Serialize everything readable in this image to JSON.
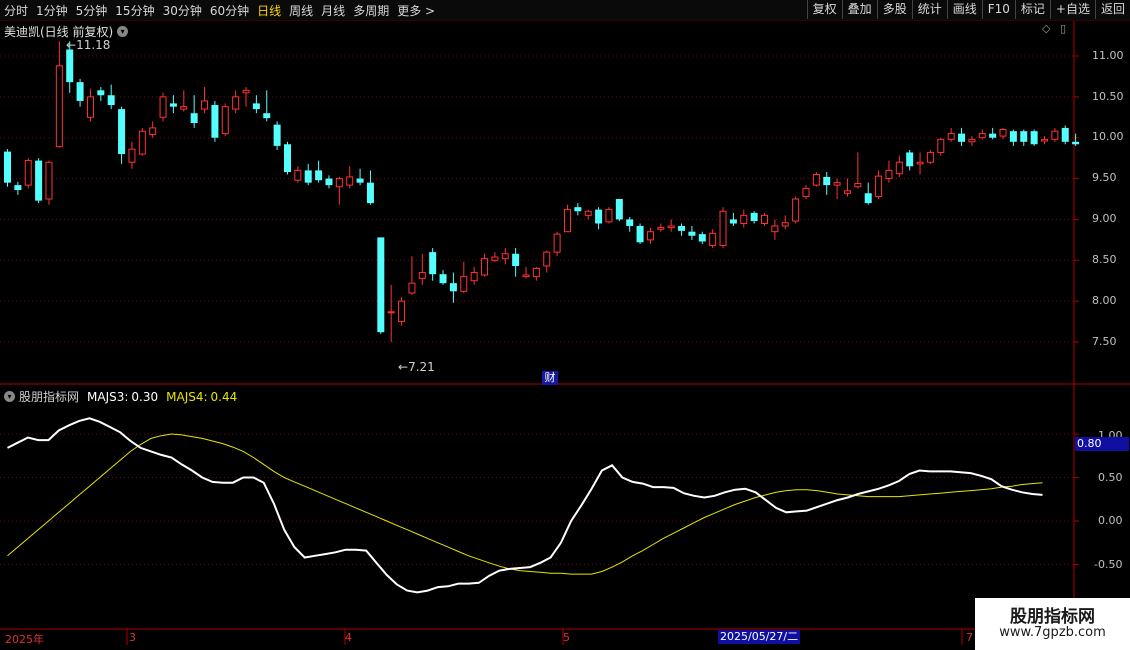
{
  "toolbar": {
    "periods": [
      "分时",
      "1分钟",
      "5分钟",
      "15分钟",
      "30分钟",
      "60分钟",
      "日线",
      "周线",
      "月线",
      "多周期",
      "更多 >"
    ],
    "active_period": "日线",
    "right_buttons": [
      "复权",
      "叠加",
      "多股",
      "统计",
      "画线",
      "F10",
      "标记",
      "+自选",
      "返回"
    ]
  },
  "stock": {
    "title": "美迪凯(日线 前复权)"
  },
  "price_axis": {
    "labels": [
      "11.00",
      "10.50",
      "10.00",
      "9.50",
      "9.00",
      "8.50",
      "8.00",
      "7.50"
    ]
  },
  "annotations": {
    "high": "11.18",
    "low": "7.21",
    "event_marker": "财"
  },
  "indicator": {
    "name": "股朋指标网",
    "majs3_label": "MAJS3:",
    "majs3_value": "0.30",
    "majs4_label": "MAJS4:",
    "majs4_value": "0.44",
    "axis_labels": [
      "0.50",
      "0.00",
      "-0.50"
    ],
    "axis_top_partial": "1.00",
    "cursor_value": "0.80"
  },
  "time_axis": {
    "labels": [
      "2025年",
      "3",
      "4",
      "5",
      "7"
    ],
    "cursor_date": "2025/05/27/二"
  },
  "watermark": {
    "line1": "股朋指标网",
    "line2": "www.7gpzb.com"
  },
  "colors": {
    "up": "#ff3232",
    "down": "#54ffff",
    "majs3": "#ffffff",
    "majs4": "#e6e600",
    "grid": "#7a0000",
    "axis_line": "#b00000",
    "cursor_bg": "#1010a0"
  },
  "chart_data": {
    "type": "candlestick",
    "price_ylim": [
      7.2,
      11.2
    ],
    "candles": [
      [
        9.83,
        9.45,
        9.86,
        9.4
      ],
      [
        9.42,
        9.36,
        9.46,
        9.3
      ],
      [
        9.42,
        9.72,
        9.75,
        9.38
      ],
      [
        9.72,
        9.23,
        9.75,
        9.2
      ],
      [
        9.25,
        9.7,
        9.72,
        9.18
      ],
      [
        9.89,
        10.88,
        11.18,
        9.88
      ],
      [
        11.08,
        10.68,
        11.18,
        10.55
      ],
      [
        10.68,
        10.45,
        10.72,
        10.38
      ],
      [
        10.25,
        10.5,
        10.6,
        10.2
      ],
      [
        10.58,
        10.52,
        10.62,
        10.45
      ],
      [
        10.52,
        10.4,
        10.65,
        10.35
      ],
      [
        10.35,
        9.8,
        10.38,
        9.68
      ],
      [
        9.7,
        9.86,
        9.95,
        9.62
      ],
      [
        9.8,
        10.08,
        10.12,
        9.78
      ],
      [
        10.04,
        10.12,
        10.2,
        10.0
      ],
      [
        10.25,
        10.5,
        10.55,
        10.2
      ],
      [
        10.42,
        10.38,
        10.52,
        10.3
      ],
      [
        10.35,
        10.38,
        10.58,
        10.32
      ],
      [
        10.3,
        10.18,
        10.52,
        10.12
      ],
      [
        10.35,
        10.45,
        10.62,
        10.3
      ],
      [
        10.4,
        10.0,
        10.45,
        9.95
      ],
      [
        10.05,
        10.38,
        10.42,
        10.02
      ],
      [
        10.35,
        10.5,
        10.58,
        10.3
      ],
      [
        10.55,
        10.58,
        10.62,
        10.38
      ],
      [
        10.42,
        10.35,
        10.52,
        10.3
      ],
      [
        10.3,
        10.24,
        10.58,
        10.2
      ],
      [
        10.16,
        9.9,
        10.2,
        9.85
      ],
      [
        9.92,
        9.58,
        9.95,
        9.55
      ],
      [
        9.48,
        9.6,
        9.65,
        9.45
      ],
      [
        9.6,
        9.45,
        9.68,
        9.42
      ],
      [
        9.6,
        9.48,
        9.72,
        9.45
      ],
      [
        9.5,
        9.42,
        9.54,
        9.38
      ],
      [
        9.4,
        9.5,
        9.52,
        9.18
      ],
      [
        9.42,
        9.52,
        9.65,
        9.38
      ],
      [
        9.5,
        9.45,
        9.62,
        9.42
      ],
      [
        9.45,
        9.2,
        9.6,
        9.18
      ],
      [
        8.78,
        7.62,
        8.78,
        7.6
      ],
      [
        7.87,
        7.87,
        8.2,
        7.5
      ],
      [
        7.75,
        8.0,
        8.05,
        7.7
      ],
      [
        8.1,
        8.22,
        8.55,
        8.08
      ],
      [
        8.28,
        8.35,
        8.58,
        8.2
      ],
      [
        8.6,
        8.33,
        8.65,
        8.25
      ],
      [
        8.33,
        8.22,
        8.38,
        8.2
      ],
      [
        8.22,
        8.12,
        8.35,
        7.98
      ],
      [
        8.12,
        8.3,
        8.48,
        8.1
      ],
      [
        8.25,
        8.35,
        8.42,
        8.2
      ],
      [
        8.32,
        8.52,
        8.58,
        8.3
      ],
      [
        8.5,
        8.54,
        8.6,
        8.48
      ],
      [
        8.52,
        8.58,
        8.65,
        8.45
      ],
      [
        8.58,
        8.43,
        8.65,
        8.3
      ],
      [
        8.3,
        8.32,
        8.42,
        8.28
      ],
      [
        8.3,
        8.4,
        8.42,
        8.25
      ],
      [
        8.43,
        8.6,
        8.62,
        8.35
      ],
      [
        8.6,
        8.82,
        8.85,
        8.55
      ],
      [
        8.85,
        9.12,
        9.18,
        8.85
      ],
      [
        9.15,
        9.1,
        9.2,
        9.05
      ],
      [
        9.05,
        9.1,
        9.12,
        9.0
      ],
      [
        9.12,
        8.95,
        9.15,
        8.88
      ],
      [
        8.97,
        9.12,
        9.15,
        8.95
      ],
      [
        9.25,
        9.0,
        9.25,
        8.98
      ],
      [
        9.0,
        8.92,
        9.03,
        8.85
      ],
      [
        8.92,
        8.72,
        8.95,
        8.7
      ],
      [
        8.75,
        8.85,
        8.9,
        8.7
      ],
      [
        8.88,
        8.9,
        8.95,
        8.85
      ],
      [
        8.9,
        8.92,
        9.0,
        8.85
      ],
      [
        8.92,
        8.86,
        8.95,
        8.8
      ],
      [
        8.85,
        8.8,
        8.92,
        8.75
      ],
      [
        8.82,
        8.73,
        8.85,
        8.7
      ],
      [
        8.68,
        8.83,
        8.88,
        8.65
      ],
      [
        8.68,
        9.1,
        9.15,
        8.65
      ],
      [
        9.0,
        8.95,
        9.08,
        8.92
      ],
      [
        8.95,
        9.05,
        9.12,
        8.9
      ],
      [
        9.08,
        8.98,
        9.1,
        8.95
      ],
      [
        8.95,
        9.05,
        9.08,
        8.92
      ],
      [
        8.85,
        8.92,
        9.0,
        8.75
      ],
      [
        8.92,
        8.96,
        9.05,
        8.88
      ],
      [
        8.98,
        9.25,
        9.28,
        8.95
      ],
      [
        9.28,
        9.38,
        9.42,
        9.25
      ],
      [
        9.42,
        9.55,
        9.58,
        9.4
      ],
      [
        9.52,
        9.42,
        9.58,
        9.3
      ],
      [
        9.42,
        9.45,
        9.5,
        9.25
      ],
      [
        9.32,
        9.35,
        9.5,
        9.28
      ],
      [
        9.4,
        9.44,
        9.82,
        9.38
      ],
      [
        9.32,
        9.2,
        9.45,
        9.18
      ],
      [
        9.28,
        9.53,
        9.6,
        9.25
      ],
      [
        9.5,
        9.6,
        9.72,
        9.45
      ],
      [
        9.56,
        9.7,
        9.78,
        9.52
      ],
      [
        9.82,
        9.65,
        9.85,
        9.6
      ],
      [
        9.68,
        9.7,
        9.82,
        9.55
      ],
      [
        9.7,
        9.82,
        9.85,
        9.68
      ],
      [
        9.82,
        9.98,
        10.0,
        9.78
      ],
      [
        9.98,
        10.05,
        10.12,
        9.95
      ],
      [
        10.05,
        9.95,
        10.12,
        9.9
      ],
      [
        9.95,
        9.98,
        10.02,
        9.9
      ],
      [
        10.0,
        10.05,
        10.1,
        9.98
      ],
      [
        10.05,
        10.0,
        10.12,
        9.98
      ],
      [
        10.02,
        10.1,
        10.12,
        9.98
      ],
      [
        10.08,
        9.95,
        10.1,
        9.9
      ],
      [
        10.08,
        9.95,
        10.1,
        9.9
      ],
      [
        10.08,
        9.92,
        10.1,
        9.9
      ],
      [
        9.96,
        9.98,
        10.02,
        9.92
      ],
      [
        9.98,
        10.08,
        10.12,
        9.95
      ],
      [
        10.12,
        9.95,
        10.15,
        9.92
      ],
      [
        9.95,
        9.92,
        10.05,
        9.9
      ]
    ],
    "indicator_ylim": [
      -0.75,
      1.35
    ],
    "majs3": [
      0.84,
      0.9,
      0.96,
      0.93,
      0.93,
      1.04,
      1.1,
      1.15,
      1.18,
      1.14,
      1.08,
      1.02,
      0.92,
      0.84,
      0.8,
      0.76,
      0.73,
      0.65,
      0.58,
      0.5,
      0.45,
      0.44,
      0.44,
      0.5,
      0.5,
      0.44,
      0.2,
      -0.1,
      -0.3,
      -0.42,
      -0.4,
      -0.38,
      -0.36,
      -0.33,
      -0.33,
      -0.34,
      -0.48,
      -0.62,
      -0.73,
      -0.8,
      -0.82,
      -0.8,
      -0.76,
      -0.75,
      -0.72,
      -0.72,
      -0.71,
      -0.63,
      -0.57,
      -0.55,
      -0.54,
      -0.53,
      -0.48,
      -0.42,
      -0.25,
      0.0,
      0.18,
      0.37,
      0.58,
      0.64,
      0.5,
      0.45,
      0.43,
      0.39,
      0.39,
      0.38,
      0.32,
      0.29,
      0.27,
      0.29,
      0.33,
      0.36,
      0.37,
      0.33,
      0.24,
      0.15,
      0.1,
      0.11,
      0.12,
      0.16,
      0.2,
      0.24,
      0.27,
      0.31,
      0.34,
      0.37,
      0.41,
      0.46,
      0.54,
      0.58,
      0.57,
      0.57,
      0.57,
      0.56,
      0.55,
      0.52,
      0.48,
      0.4,
      0.36,
      0.33,
      0.31,
      0.3
    ],
    "majs4": [
      -0.4,
      -0.3,
      -0.2,
      -0.1,
      0.0,
      0.1,
      0.2,
      0.3,
      0.4,
      0.5,
      0.6,
      0.7,
      0.8,
      0.88,
      0.95,
      0.98,
      1.0,
      0.99,
      0.97,
      0.95,
      0.92,
      0.89,
      0.85,
      0.8,
      0.73,
      0.65,
      0.57,
      0.5,
      0.45,
      0.4,
      0.35,
      0.3,
      0.25,
      0.2,
      0.15,
      0.1,
      0.05,
      0.0,
      -0.05,
      -0.1,
      -0.15,
      -0.2,
      -0.25,
      -0.3,
      -0.35,
      -0.4,
      -0.44,
      -0.48,
      -0.52,
      -0.55,
      -0.57,
      -0.58,
      -0.59,
      -0.6,
      -0.6,
      -0.61,
      -0.61,
      -0.61,
      -0.58,
      -0.53,
      -0.47,
      -0.4,
      -0.34,
      -0.27,
      -0.2,
      -0.14,
      -0.08,
      -0.02,
      0.04,
      0.09,
      0.14,
      0.19,
      0.23,
      0.27,
      0.3,
      0.33,
      0.35,
      0.36,
      0.36,
      0.35,
      0.33,
      0.31,
      0.3,
      0.29,
      0.28,
      0.28,
      0.28,
      0.28,
      0.29,
      0.3,
      0.31,
      0.32,
      0.33,
      0.34,
      0.35,
      0.36,
      0.37,
      0.39,
      0.4,
      0.42,
      0.43,
      0.44
    ]
  }
}
